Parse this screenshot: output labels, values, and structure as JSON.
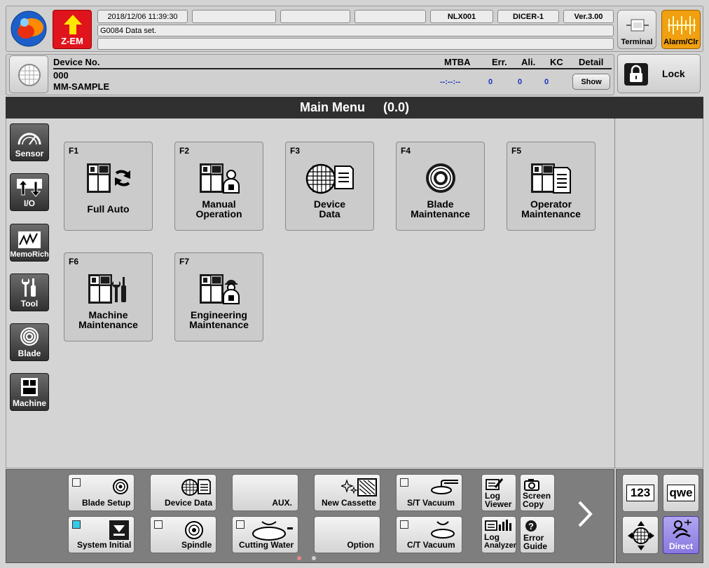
{
  "header": {
    "logo_label": "Z-EM",
    "datetime": "2018/12/06 11:39:30",
    "machine_id": "NLX001",
    "model": "DICER-1",
    "version": "Ver.3.00",
    "message": "G0084  Data set.",
    "terminal_label": "Terminal",
    "alarm_label": "Alarm/Clr"
  },
  "device": {
    "no_label": "Device No.",
    "number": "000",
    "name": "MM-SAMPLE",
    "mtba_label": "MTBA",
    "err_label": "Err.",
    "ali_label": "Ali.",
    "kc_label": "KC",
    "detail_label": "Detail",
    "mtba_value": "--:--:--",
    "err_value": "0",
    "ali_value": "0",
    "kc_value": "0",
    "show_label": "Show",
    "lock_label": "Lock"
  },
  "main": {
    "title": "Main Menu",
    "code": "(0.0)"
  },
  "side": {
    "sensor": "Sensor",
    "io": "I/O",
    "memorich": "MemoRich",
    "tool": "Tool",
    "blade": "Blade",
    "machine": "Machine"
  },
  "menu": {
    "f1": {
      "key": "F1",
      "l1": "Full Auto",
      "l2": ""
    },
    "f2": {
      "key": "F2",
      "l1": "Manual",
      "l2": "Operation"
    },
    "f3": {
      "key": "F3",
      "l1": "Device",
      "l2": "Data"
    },
    "f4": {
      "key": "F4",
      "l1": "Blade",
      "l2": "Maintenance"
    },
    "f5": {
      "key": "F5",
      "l1": "Operator",
      "l2": "Maintenance"
    },
    "f6": {
      "key": "F6",
      "l1": "Machine",
      "l2": "Maintenance"
    },
    "f7": {
      "key": "F7",
      "l1": "Engineering",
      "l2": "Maintenance"
    }
  },
  "bottom": {
    "blade_setup": "Blade Setup",
    "device_data": "Device Data",
    "aux": "AUX.",
    "new_cassette": "New Cassette",
    "st_vacuum": "S/T Vacuum",
    "log_viewer_1": "Log",
    "log_viewer_2": "Viewer",
    "screen_copy_1": "Screen",
    "screen_copy_2": "Copy",
    "system_initial": "System Initial",
    "spindle": "Spindle",
    "cutting_water": "Cutting Water",
    "option": "Option",
    "ct_vacuum": "C/T Vacuum",
    "log_analyzer_1": "Log",
    "log_analyzer_2": "Analyzer",
    "error_guide_1": "Error",
    "error_guide_2": "Guide",
    "num_key": "123",
    "alpha_key": "qwe",
    "direct": "Direct"
  }
}
